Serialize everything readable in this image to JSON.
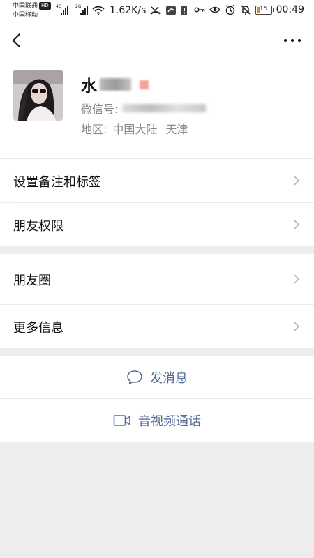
{
  "status_bar": {
    "carrier_1": "中国联通",
    "carrier_1_badge": "HD",
    "carrier_2": "中国移动",
    "network_1": "4G",
    "network_2": "2G",
    "speed": "1.62K/s",
    "battery": "15",
    "time": "00:49",
    "battery_color": "#e4872a"
  },
  "nav": {
    "back_icon": "chevron-left-icon",
    "more_icon": "more-dots-icon"
  },
  "profile": {
    "name": "水",
    "wechat_id_label": "微信号:",
    "region_label": "地区:",
    "region_country": "中国大陆",
    "region_city": "天津"
  },
  "menu": {
    "remark_tags": "设置备注和标签",
    "permissions": "朋友权限",
    "moments": "朋友圈",
    "more_info": "更多信息"
  },
  "actions": {
    "send_message": "发消息",
    "video_call": "音视频通话",
    "link_color": "#576b95"
  }
}
